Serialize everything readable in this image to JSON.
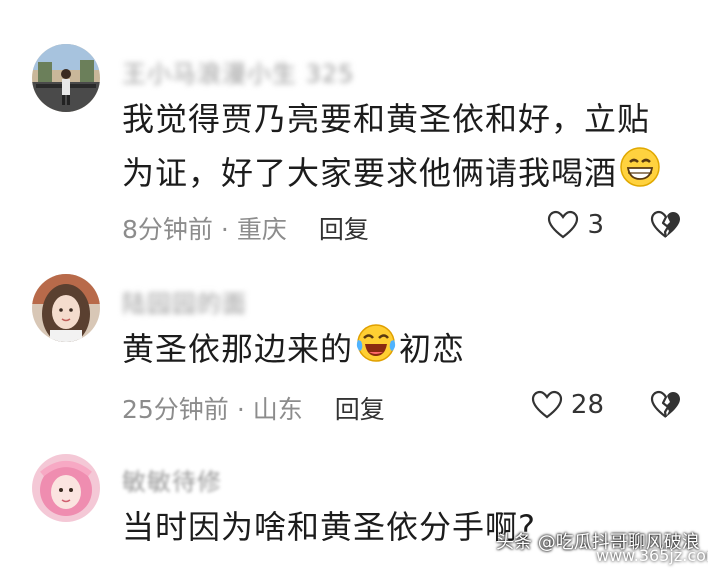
{
  "comments": [
    {
      "username_visible": "325",
      "text_line1": "我觉得贾乃亮要和黄圣依和好，立贴",
      "text_line2": "为证，好了大家要求他俩请我喝酒",
      "time": "8分钟前",
      "location": "重庆",
      "reply_label": "回复",
      "likes": "3",
      "emoji": "grinning-face"
    },
    {
      "username_visible": "",
      "text_before": "黄圣依那边来的",
      "text_after": "初恋",
      "time": "25分钟前",
      "location": "山东",
      "reply_label": "回复",
      "likes": "28",
      "emoji": "crying-laughing-face"
    },
    {
      "username_visible": "敏敏",
      "text_line1": "当时因为啥和黄圣依分手啊?"
    }
  ],
  "watermark": {
    "line1": "头条 @吃瓜抖哥聊风破浪",
    "line2": "www.365jz.com"
  },
  "colors": {
    "text": "#1c1c1c",
    "meta": "#8c8c8c",
    "background": "#ffffff"
  }
}
